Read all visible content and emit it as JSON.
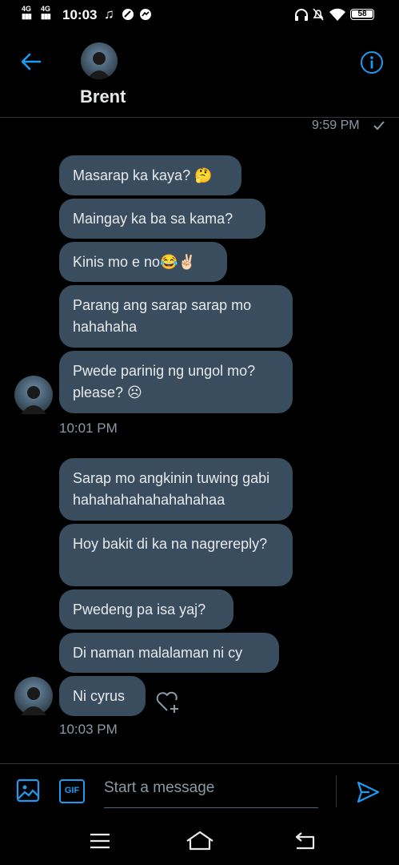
{
  "status_bar": {
    "time": "10:03",
    "network_1": "4G",
    "network_2": "4G",
    "battery": "58",
    "icons": [
      "music-note-icon",
      "dnd-app-icon",
      "messenger-icon",
      "headphones-icon",
      "mute-icon",
      "wifi-icon",
      "battery-icon"
    ]
  },
  "header": {
    "contact_name": "Brent",
    "back_icon": "arrow-left-icon",
    "info_icon": "info-icon"
  },
  "last_sent": {
    "time": "9:59 PM",
    "status_icon": "check-icon"
  },
  "groups": [
    {
      "messages": [
        "Masarap ka kaya? 🤔",
        "Maingay ka ba sa kama?",
        "Kinis mo e no😂✌🏻",
        "Parang ang sarap sarap mo hahahaha",
        "Pwede parinig ng ungol mo? please? ☹"
      ],
      "timestamp": "10:01 PM"
    },
    {
      "messages": [
        "Sarap mo angkinin tuwing gabi hahahahahahahahahaa",
        "Hoy bakit di ka na nagrereply?",
        "Pwedeng pa isa yaj?",
        "Di naman malalaman ni cy",
        "Ni cyrus"
      ],
      "timestamp": "10:03 PM"
    }
  ],
  "composer": {
    "placeholder": "Start a message",
    "image_icon": "image-icon",
    "gif_label": "GIF",
    "send_icon": "send-icon"
  },
  "colors": {
    "accent": "#1d9bf0",
    "bubble": "#3a4d5f",
    "background": "#000000",
    "muted_text": "#8b98a5"
  }
}
